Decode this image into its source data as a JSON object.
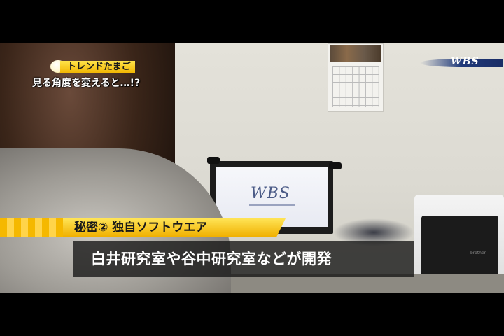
{
  "corner_tag": {
    "title": "トレンドたまご",
    "subtitle": "見る角度を変えると…!?"
  },
  "bug": {
    "logo": "WBS"
  },
  "screen": {
    "logo": "WBS"
  },
  "printer": {
    "brand": "brother"
  },
  "caption": {
    "heading": "秘密② 独自ソフトウエア",
    "body": "白井研究室や谷中研究室などが開発"
  },
  "colors": {
    "caption_yellow": "#f5c400",
    "caption_dark": "#141414",
    "bug_blue": "#1a2d66"
  }
}
